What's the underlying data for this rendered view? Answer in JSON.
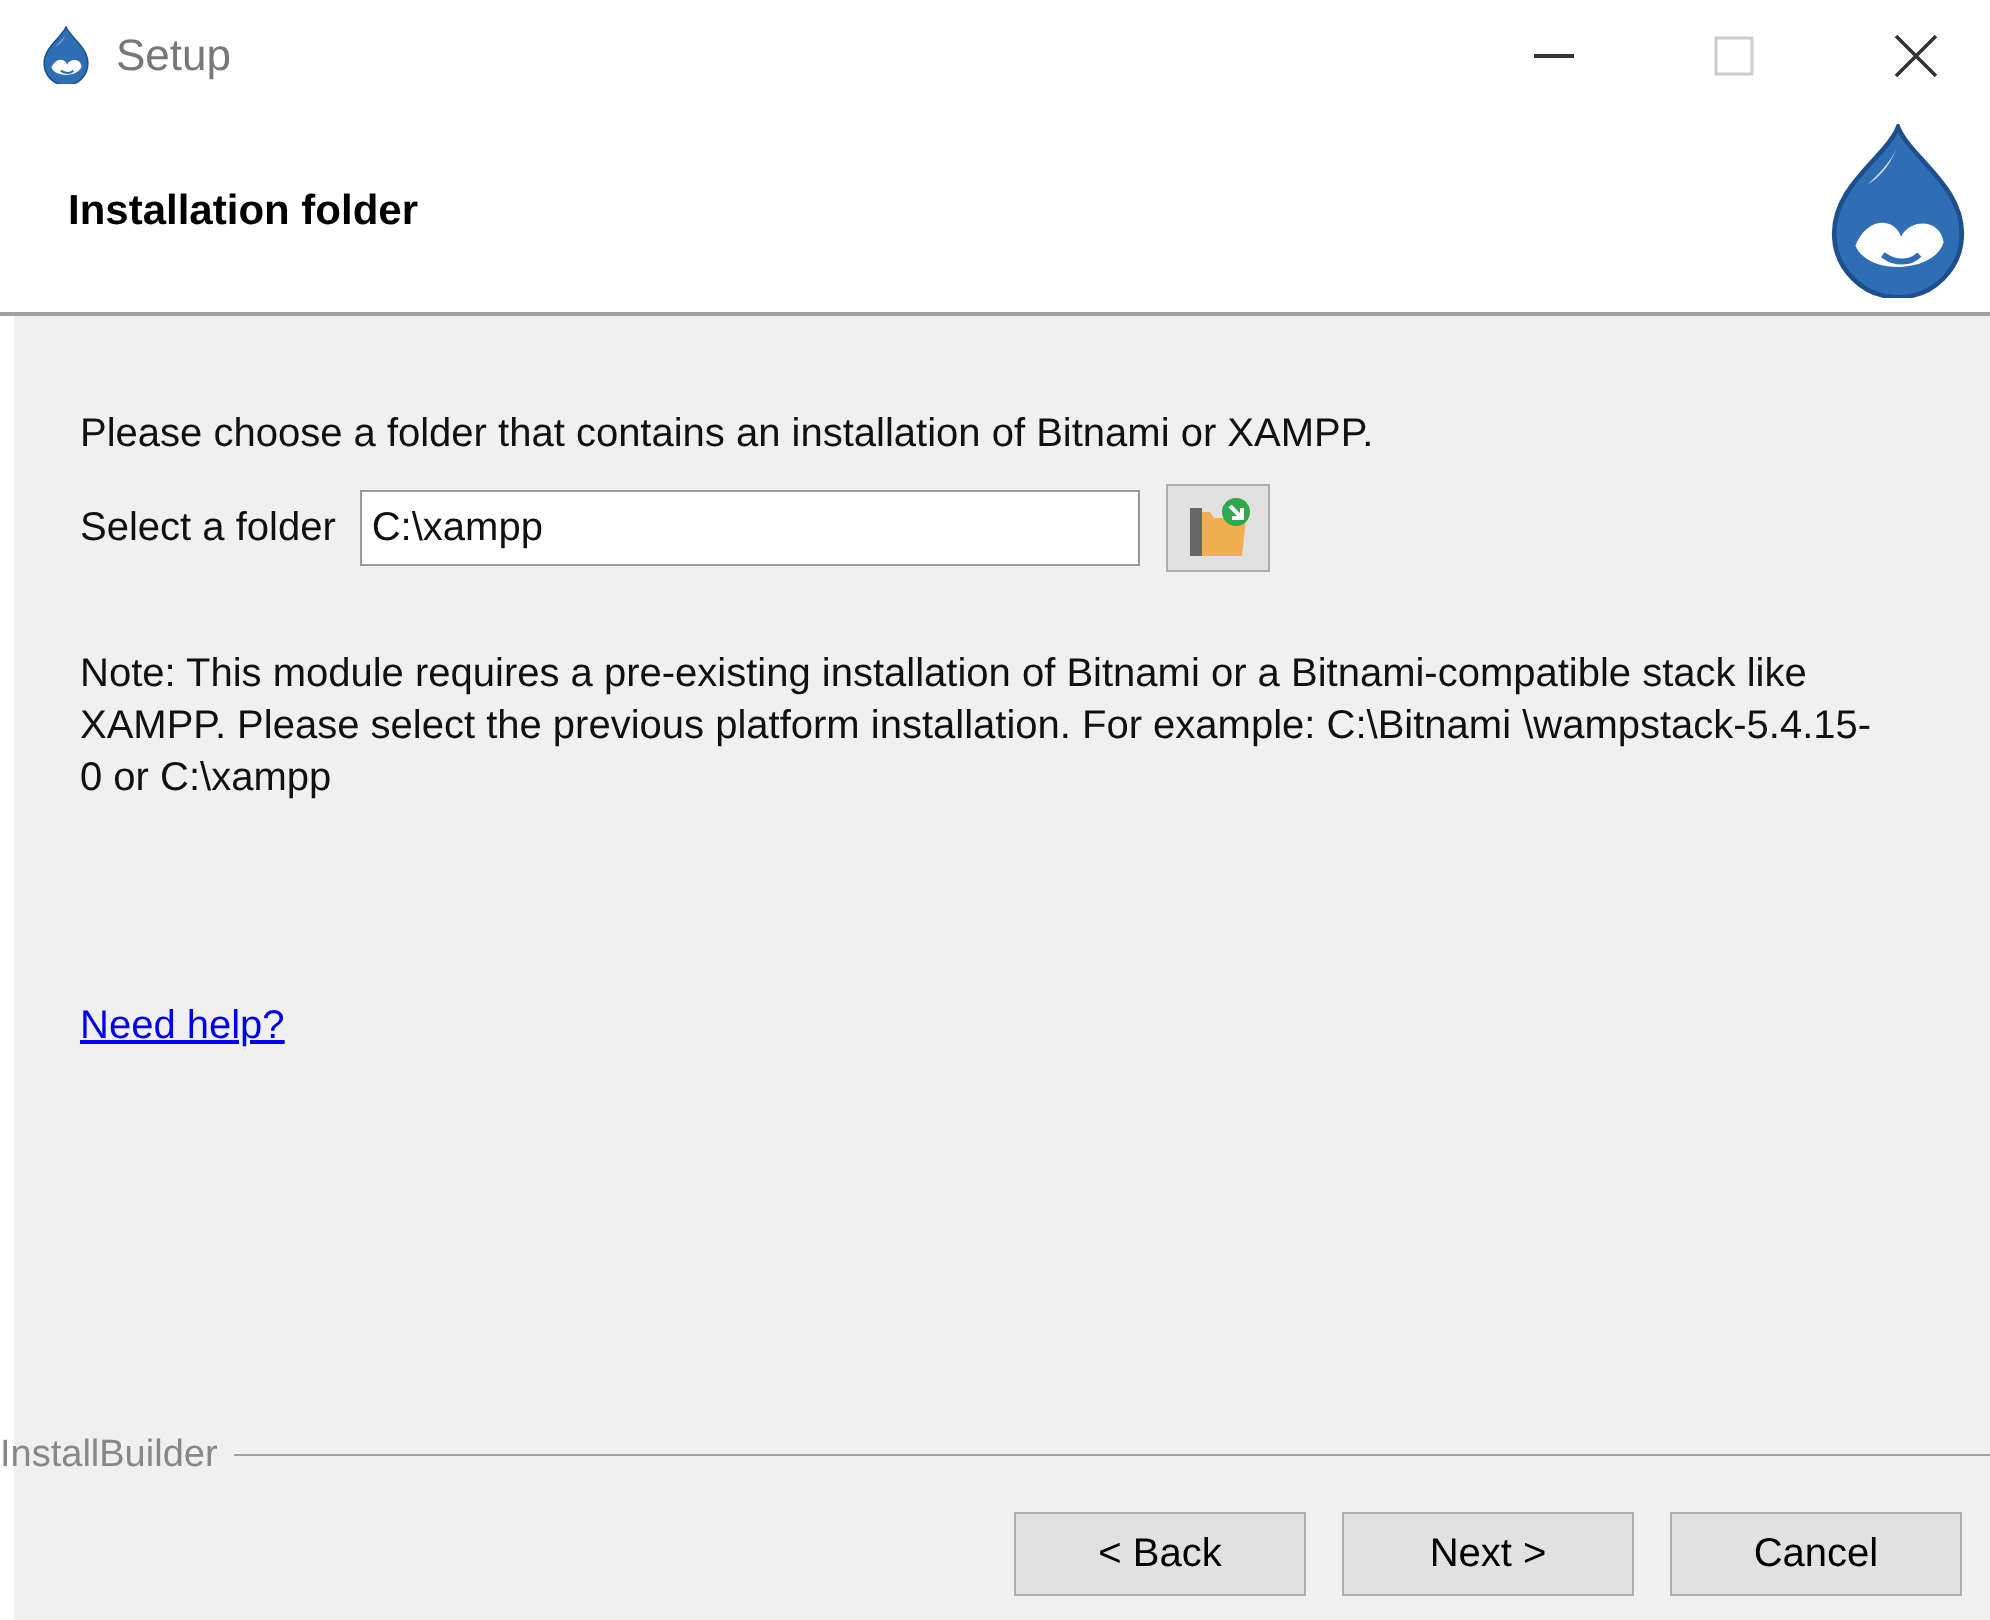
{
  "window": {
    "title": "Setup"
  },
  "header": {
    "title": "Installation folder"
  },
  "intro": "Please choose a folder that contains an installation of Bitnami or XAMPP.",
  "folder_field": {
    "label": "Select a folder",
    "value": "C:\\xampp"
  },
  "note": "Note: This module requires a pre-existing installation of Bitnami or a Bitnami-compatible stack like XAMPP. Please select the previous platform installation. For example: C:\\Bitnami \\wampstack-5.4.15-0 or C:\\xampp",
  "help_link": "Need help?",
  "footer": {
    "brand": "InstallBuilder",
    "buttons": [
      "< Back",
      "Next >",
      "Cancel"
    ]
  }
}
